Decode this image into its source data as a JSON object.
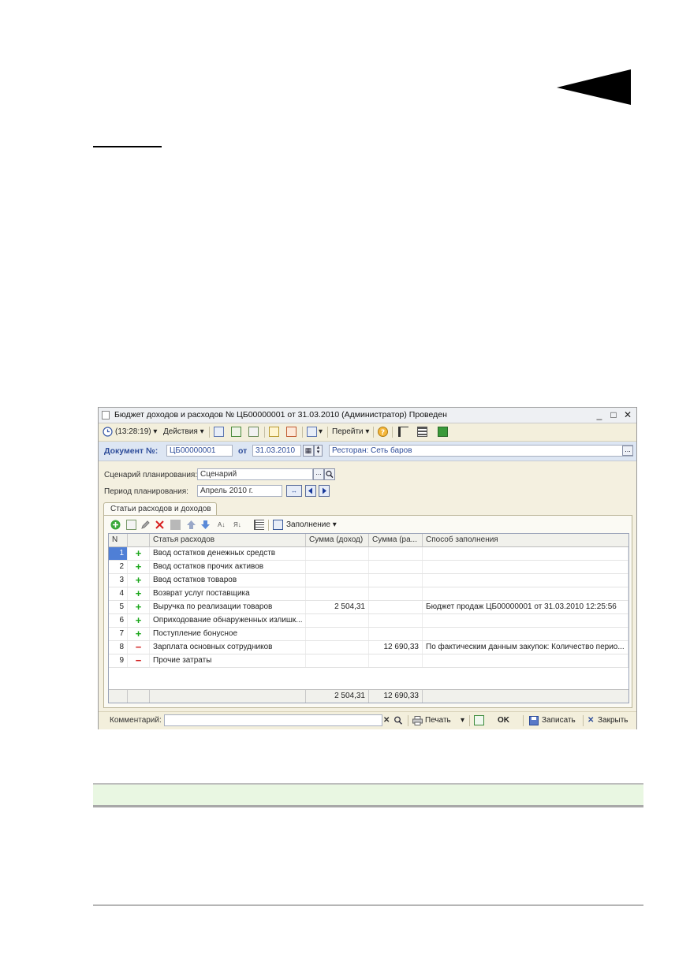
{
  "window": {
    "title": "Бюджет доходов и расходов № ЦБ00000001 от 31.03.2010 (Администратор) Проведен",
    "minimize": "_",
    "maximize": "□",
    "close": "✕"
  },
  "toolbar": {
    "time": "(13:28:19)",
    "actions": "Действия",
    "goto": "Перейти"
  },
  "document": {
    "number_label": "Документ №:",
    "number": "ЦБ00000001",
    "date_label": "от",
    "date": "31.03.2010",
    "organization": "Ресторан: Сеть баров"
  },
  "form": {
    "scenario_label": "Сценарий планирования:",
    "scenario": "Сценарий",
    "period_label": "Период планирования:",
    "period": "Апрель 2010 г."
  },
  "tab": {
    "label": "Статьи расходов и доходов",
    "fill_button": "Заполнение"
  },
  "table": {
    "columns": [
      "N",
      "",
      "Статья расходов",
      "Сумма (доход)",
      "Сумма (ра...",
      "Способ заполнения"
    ],
    "rows": [
      {
        "n": "1",
        "sign": "+",
        "item": "Ввод остатков денежных средств",
        "income": "",
        "expense": "",
        "method": ""
      },
      {
        "n": "2",
        "sign": "+",
        "item": "Ввод остатков прочих активов",
        "income": "",
        "expense": "",
        "method": ""
      },
      {
        "n": "3",
        "sign": "+",
        "item": "Ввод остатков товаров",
        "income": "",
        "expense": "",
        "method": ""
      },
      {
        "n": "4",
        "sign": "+",
        "item": "Возврат услуг поставщика",
        "income": "",
        "expense": "",
        "method": ""
      },
      {
        "n": "5",
        "sign": "+",
        "item": "Выручка по реализации товаров",
        "income": "2 504,31",
        "expense": "",
        "method": "Бюджет продаж ЦБ00000001 от 31.03.2010 12:25:56"
      },
      {
        "n": "6",
        "sign": "+",
        "item": "Оприходование обнаруженных излишк...",
        "income": "",
        "expense": "",
        "method": ""
      },
      {
        "n": "7",
        "sign": "+",
        "item": "Поступление бонусное",
        "income": "",
        "expense": "",
        "method": ""
      },
      {
        "n": "8",
        "sign": "−",
        "item": "Зарплата основных сотрудников",
        "income": "",
        "expense": "12 690,33",
        "method": "По фактическим данным закупок: Количество перио..."
      },
      {
        "n": "9",
        "sign": "−",
        "item": "Прочие затраты",
        "income": "",
        "expense": "",
        "method": ""
      }
    ],
    "total_income": "2 504,31",
    "total_expense": "12 690,33"
  },
  "footer": {
    "comment_label": "Комментарий:",
    "comment": "",
    "print": "Печать",
    "ok": "OK",
    "save": "Записать",
    "close": "Закрыть"
  }
}
